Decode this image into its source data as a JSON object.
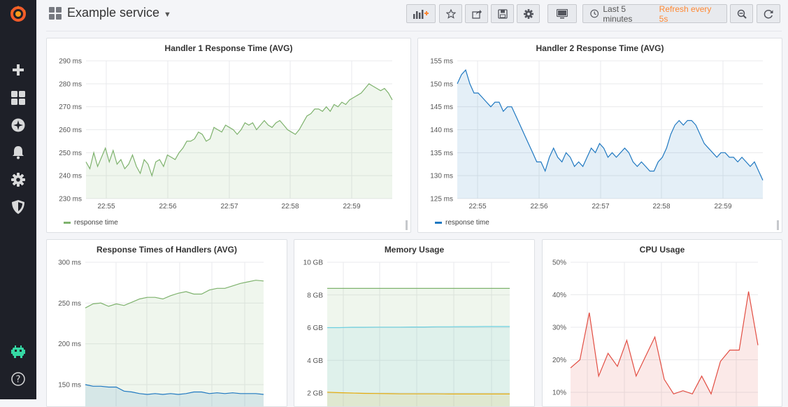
{
  "header": {
    "dashboard_title": "Example service",
    "time_range": "Last 5 minutes",
    "refresh": "Refresh every 5s"
  },
  "toolbar_icons": [
    "add-panel-icon",
    "star-icon",
    "share-icon",
    "save-icon",
    "settings-icon",
    "tv-mode-icon",
    "clock-icon",
    "zoom-out-icon",
    "refresh-icon"
  ],
  "sidebar_icons": [
    "grafana-logo",
    "plus-icon",
    "dashboards-icon",
    "explore-compass-icon",
    "alerting-bell-icon",
    "configuration-gear-icon",
    "shield-icon",
    "user-avatar-icon",
    "help-icon"
  ],
  "colors": {
    "green": "#7eb26d",
    "blue": "#1f78c1",
    "cyan": "#6ed0e0",
    "yellow": "#e5ac0e",
    "red": "#e24d42",
    "orange": "#ff8833"
  },
  "panels": [
    {
      "title": "Handler 1 Response Time (AVG)",
      "legend": "response time",
      "color": "#7eb26d"
    },
    {
      "title": "Handler 2 Response Time (AVG)",
      "legend": "response time",
      "color": "#1f78c1"
    },
    {
      "title": "Response Times of Handlers (AVG)"
    },
    {
      "title": "Memory Usage"
    },
    {
      "title": "CPU Usage"
    }
  ],
  "chart_data": [
    {
      "type": "area",
      "title": "Handler 1 Response Time (AVG)",
      "x_ticks": [
        "22:55",
        "22:56",
        "22:57",
        "22:58",
        "22:59"
      ],
      "y_ticks": [
        "230 ms",
        "240 ms",
        "250 ms",
        "260 ms",
        "270 ms",
        "280 ms",
        "290 ms"
      ],
      "ylim": [
        230,
        290
      ],
      "grid": true,
      "legend_position": "bottom-left",
      "series": [
        {
          "name": "response time",
          "color": "#7eb26d",
          "values": [
            246,
            243,
            250,
            244,
            248,
            252,
            246,
            251,
            245,
            247,
            243,
            245,
            249,
            244,
            241,
            247,
            245,
            240,
            246,
            247,
            244,
            249,
            248,
            247,
            250,
            252,
            255,
            255,
            256,
            259,
            258,
            255,
            256,
            261,
            260,
            259,
            262,
            261,
            260,
            258,
            260,
            263,
            262,
            263,
            260,
            262,
            264,
            262,
            261,
            263,
            264,
            262,
            260,
            259,
            258,
            260,
            263,
            266,
            267,
            269,
            269,
            268,
            270,
            268,
            271,
            270,
            272,
            271,
            273,
            274,
            275,
            276,
            278,
            280,
            279,
            278,
            277,
            278,
            276,
            273
          ]
        }
      ]
    },
    {
      "type": "area",
      "title": "Handler 2 Response Time (AVG)",
      "x_ticks": [
        "22:55",
        "22:56",
        "22:57",
        "22:58",
        "22:59"
      ],
      "y_ticks": [
        "125 ms",
        "130 ms",
        "135 ms",
        "140 ms",
        "145 ms",
        "150 ms",
        "155 ms"
      ],
      "ylim": [
        125,
        155
      ],
      "grid": true,
      "legend_position": "bottom-left",
      "series": [
        {
          "name": "response time",
          "color": "#1f78c1",
          "values": [
            150,
            152,
            153,
            150,
            148,
            148,
            147,
            146,
            145,
            146,
            146,
            144,
            145,
            145,
            143,
            141,
            139,
            137,
            135,
            133,
            133,
            131,
            134,
            136,
            134,
            133,
            135,
            134,
            132,
            133,
            132,
            134,
            136,
            135,
            137,
            136,
            134,
            135,
            134,
            135,
            136,
            135,
            133,
            132,
            133,
            132,
            131,
            131,
            133,
            134,
            136,
            139,
            141,
            142,
            141,
            142,
            142,
            141,
            139,
            137,
            136,
            135,
            134,
            135,
            135,
            134,
            134,
            133,
            134,
            133,
            132,
            133,
            131,
            129
          ]
        }
      ]
    },
    {
      "type": "area",
      "title": "Response Times of Handlers (AVG)",
      "y_ticks": [
        "150 ms",
        "200 ms",
        "250 ms",
        "300 ms"
      ],
      "grid": true,
      "series": [
        {
          "color": "#7eb26d",
          "values": [
            244,
            249,
            250,
            246,
            249,
            247,
            251,
            255,
            257,
            257,
            255,
            259,
            262,
            264,
            261,
            261,
            266,
            268,
            268,
            271,
            274,
            276,
            278,
            277
          ]
        },
        {
          "color": "#1f78c1",
          "values": [
            150,
            148,
            148,
            147,
            147,
            142,
            141,
            139,
            138,
            139,
            138,
            139,
            138,
            139,
            141,
            141,
            139,
            140,
            139,
            140,
            139,
            139,
            139,
            138
          ]
        }
      ]
    },
    {
      "type": "area",
      "title": "Memory Usage",
      "y_ticks": [
        "2 GB",
        "4 GB",
        "6 GB",
        "8 GB",
        "10 GB"
      ],
      "grid": true,
      "series": [
        {
          "color": "#7eb26d",
          "values": [
            8.4,
            8.4,
            8.4,
            8.4,
            8.4,
            8.4,
            8.4,
            8.4,
            8.4,
            8.4,
            8.4,
            8.4,
            8.4,
            8.4,
            8.4,
            8.4
          ]
        },
        {
          "color": "#6ed0e0",
          "values": [
            6.0,
            6.0,
            6.02,
            6.02,
            6.03,
            6.03,
            6.03,
            6.04,
            6.04,
            6.05,
            6.05,
            6.06,
            6.06,
            6.07,
            6.07,
            6.07
          ]
        },
        {
          "color": "#e5ac0e",
          "values": [
            2.05,
            2.02,
            2.0,
            1.98,
            1.97,
            1.96,
            1.95,
            1.95,
            1.95,
            1.95,
            1.94,
            1.94,
            1.94,
            1.94,
            1.94,
            1.94
          ]
        }
      ]
    },
    {
      "type": "area",
      "title": "CPU Usage",
      "y_ticks": [
        "10%",
        "20%",
        "30%",
        "40%",
        "50%"
      ],
      "grid": true,
      "series": [
        {
          "color": "#e24d42",
          "values": [
            17.5,
            20,
            34.5,
            15,
            22,
            18,
            26,
            15,
            21,
            27,
            14,
            9.5,
            10.5,
            9.5,
            15,
            9.5,
            19.5,
            23,
            23,
            41,
            24.5
          ]
        }
      ]
    }
  ]
}
